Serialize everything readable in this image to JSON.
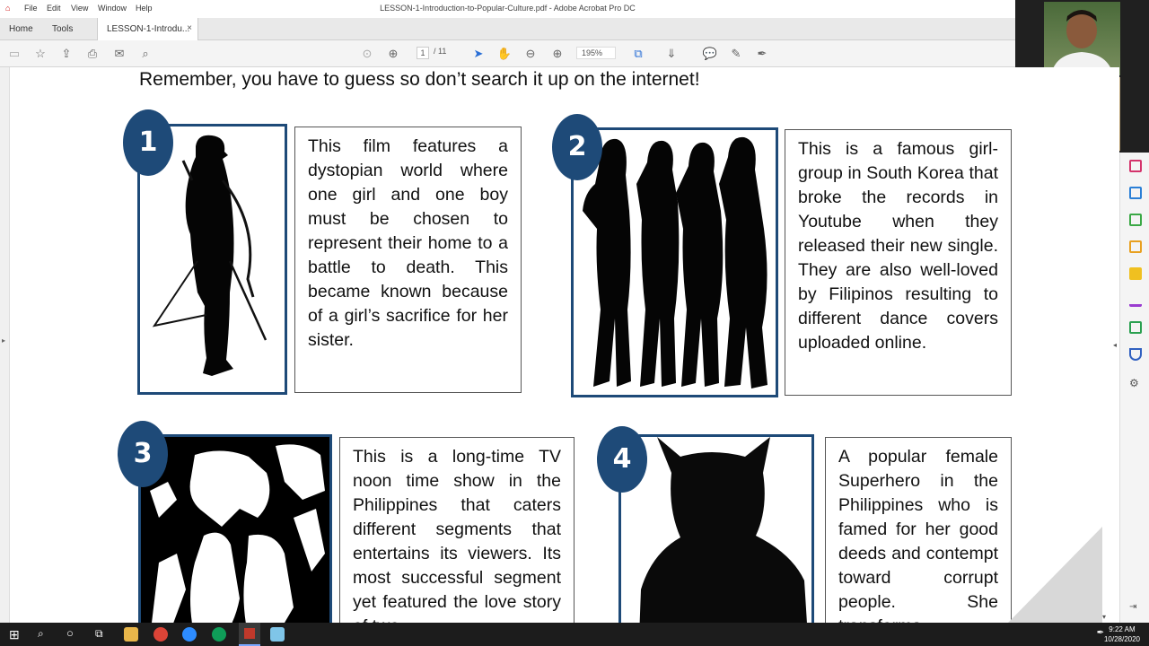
{
  "window": {
    "title": "LESSON-1-Introduction-to-Popular-Culture.pdf - Adobe Acrobat Pro DC",
    "menu": [
      "File",
      "Edit",
      "View",
      "Window",
      "Help"
    ]
  },
  "tabs": {
    "home": "Home",
    "tools": "Tools",
    "document": "LESSON-1-Introdu...",
    "close": "×"
  },
  "toolbar": {
    "page_current": "1",
    "page_total": "/ 11",
    "zoom": "195%"
  },
  "page": {
    "heading": "Remember, you have to guess so don’t search it up on the internet!",
    "items": [
      {
        "number": "1",
        "text": "This film features a dystopian world where one girl and one boy must be chosen to represent their home to a battle to death. This became known because of a girl’s sacrifice for her sister."
      },
      {
        "number": "2",
        "text": "This is a famous girl-group in South Korea that broke the records in Youtube when they released their new single. They are also well-loved by Filipinos resulting to different dance covers uploaded online."
      },
      {
        "number": "3",
        "text": "This is a long-time TV noon time show in the Philippines that caters different segments that entertains its viewers. Its most successful segment yet featured the love story of two"
      },
      {
        "number": "4",
        "text": "A popular female Superhero in the Philippines who is famed for her good deeds and contempt toward corrupt people. She transforms"
      }
    ]
  },
  "taskbar": {
    "time": "9:22 AM",
    "date": "10/28/2020"
  },
  "colors": {
    "badge": "#1e4a78",
    "frame": "#1e4a78"
  }
}
